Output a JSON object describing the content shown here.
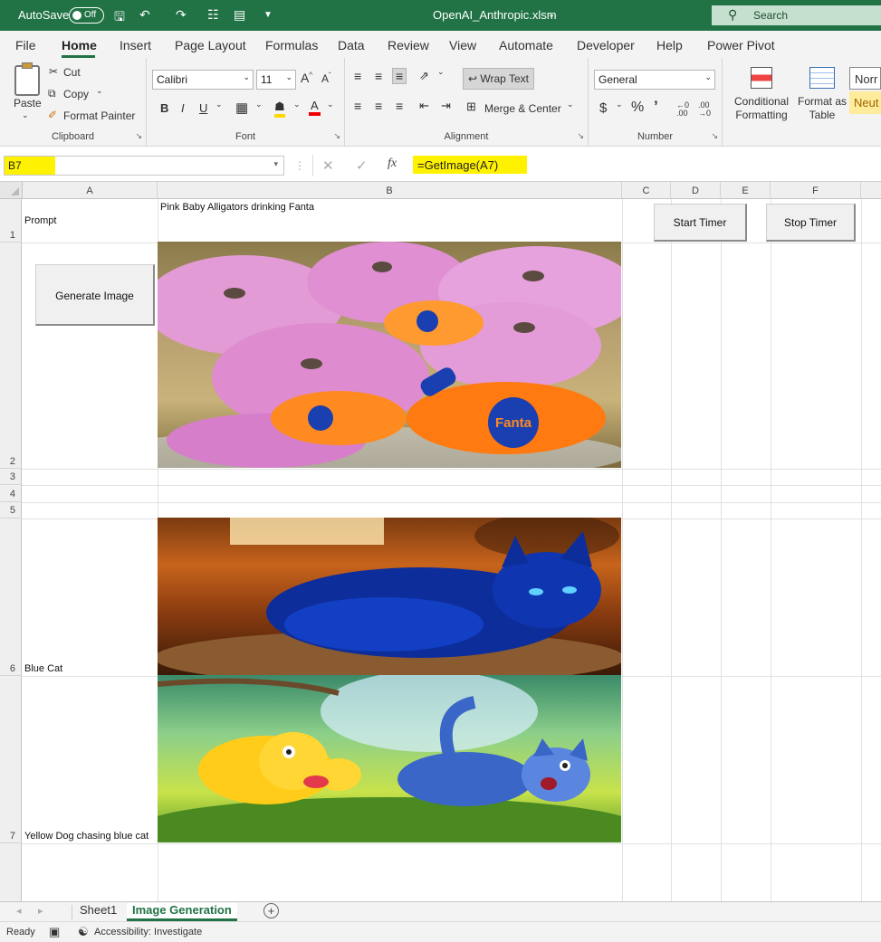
{
  "titlebar": {
    "autosave": "AutoSave",
    "toggle": "Off",
    "filename": "OpenAI_Anthropic.xlsm",
    "search": "Search"
  },
  "menu": [
    "File",
    "Home",
    "Insert",
    "Page Layout",
    "Formulas",
    "Data",
    "Review",
    "View",
    "Automate",
    "Developer",
    "Help",
    "Power Pivot"
  ],
  "ribbon": {
    "clipboard": {
      "paste": "Paste",
      "cut": "Cut",
      "copy": "Copy",
      "format_painter": "Format Painter",
      "label": "Clipboard"
    },
    "font": {
      "name": "Calibri",
      "size": "11",
      "label": "Font"
    },
    "alignment": {
      "wrap": "Wrap Text",
      "merge": "Merge & Center",
      "label": "Alignment"
    },
    "number": {
      "format": "General",
      "label": "Number"
    },
    "styles": {
      "cond1": "Conditional",
      "cond2": "Formatting",
      "fmt1": "Format as",
      "fmt2": "Table",
      "normal": "Norr",
      "neutral": "Neut"
    }
  },
  "formula_bar": {
    "cell_ref": "B7",
    "formula": "=GetImage(A7)"
  },
  "columns": [
    "A",
    "B",
    "C",
    "D",
    "E",
    "F"
  ],
  "rows": [
    "1",
    "2",
    "3",
    "4",
    "5",
    "6",
    "7"
  ],
  "cells": {
    "a1": "Prompt",
    "b1": "Pink Baby Alligators drinking Fanta",
    "a6": "Blue  Cat",
    "a7": "Yellow Dog chasing blue cat"
  },
  "buttons": {
    "start": "Start Timer",
    "stop": "Stop Timer",
    "generate": "Generate Image"
  },
  "images": {
    "img1": "Fanta"
  },
  "sheet_tabs": [
    "Sheet1",
    "Image Generation"
  ],
  "status": {
    "ready": "Ready",
    "accessibility": "Accessibility: Investigate"
  },
  "colors": {
    "excel_green": "#217346",
    "highlight": "#fff200"
  }
}
